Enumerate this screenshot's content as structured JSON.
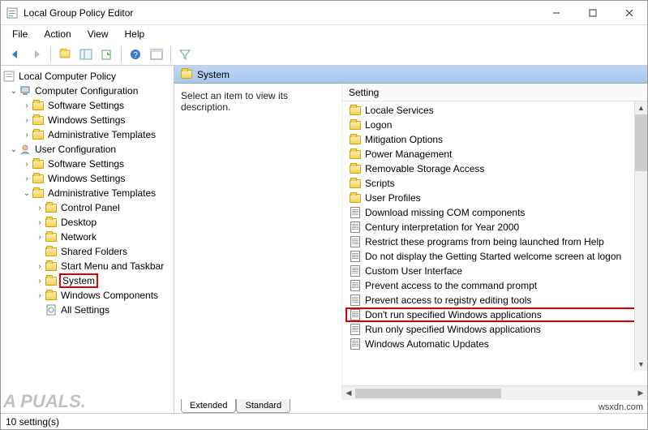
{
  "window": {
    "title": "Local Group Policy Editor"
  },
  "menu": {
    "file": "File",
    "action": "Action",
    "view": "View",
    "help": "Help"
  },
  "tree": {
    "root": "Local Computer Policy",
    "computer_config": "Computer Configuration",
    "cc_software": "Software Settings",
    "cc_windows": "Windows Settings",
    "cc_admin": "Administrative Templates",
    "user_config": "User Configuration",
    "uc_software": "Software Settings",
    "uc_windows": "Windows Settings",
    "uc_admin": "Administrative Templates",
    "control_panel": "Control Panel",
    "desktop": "Desktop",
    "network": "Network",
    "shared_folders": "Shared Folders",
    "start_menu": "Start Menu and Taskbar",
    "system": "System",
    "windows_components": "Windows Components",
    "all_settings": "All Settings"
  },
  "header": {
    "section": "System"
  },
  "right": {
    "desc": "Select an item to view its description.",
    "col_setting": "Setting"
  },
  "settings": {
    "folders": [
      "Locale Services",
      "Logon",
      "Mitigation Options",
      "Power Management",
      "Removable Storage Access",
      "Scripts",
      "User Profiles"
    ],
    "items": [
      "Download missing COM components",
      "Century interpretation for Year 2000",
      "Restrict these programs from being launched from Help",
      "Do not display the Getting Started welcome screen at logon",
      "Custom User Interface",
      "Prevent access to the command prompt",
      "Prevent access to registry editing tools",
      "Don't run specified Windows applications",
      "Run only specified Windows applications",
      "Windows Automatic Updates"
    ],
    "highlighted_index": 7
  },
  "tabs": {
    "extended": "Extended",
    "standard": "Standard"
  },
  "status": "10 setting(s)",
  "watermark": "wsxdn.com",
  "logo": "A  PUALS."
}
